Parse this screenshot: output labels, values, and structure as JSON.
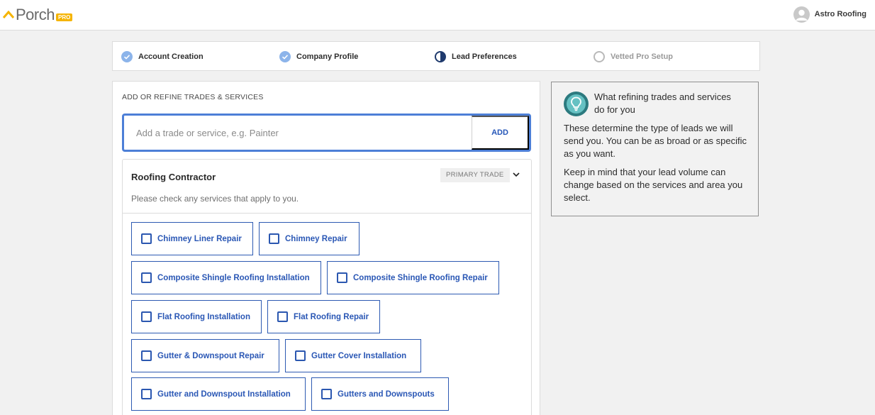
{
  "brand": {
    "logo_text": "Porch",
    "logo_badge": "PRO",
    "logo_color": "#f5b400"
  },
  "user": {
    "name": "Astro Roofing",
    "icon": "user-avatar-icon"
  },
  "stepper": {
    "steps": [
      {
        "label": "Account Creation",
        "status": "complete"
      },
      {
        "label": "Company Profile",
        "status": "complete"
      },
      {
        "label": "Lead Preferences",
        "status": "in-progress"
      },
      {
        "label": "Vetted Pro Setup",
        "status": "pending"
      }
    ]
  },
  "main": {
    "section_title": "ADD OR REFINE TRADES & SERVICES",
    "add": {
      "placeholder": "Add a trade or service, e.g. Painter",
      "value": "",
      "button_label": "ADD"
    },
    "trade": {
      "name": "Roofing Contractor",
      "badge": "PRIMARY TRADE",
      "subtitle": "Please check any services that apply to you.",
      "services": [
        {
          "label": "Chimney Liner Repair",
          "checked": false
        },
        {
          "label": "Chimney Repair",
          "checked": false
        },
        {
          "label": "Composite Shingle Roofing Installation",
          "checked": false
        },
        {
          "label": "Composite Shingle Roofing Repair",
          "checked": false
        },
        {
          "label": "Flat Roofing Installation",
          "checked": false
        },
        {
          "label": "Flat Roofing Repair",
          "checked": false
        },
        {
          "label": "Gutter & Downspout Repair",
          "checked": false
        },
        {
          "label": "Gutter Cover Installation",
          "checked": false
        },
        {
          "label": "Gutter and Downspout Installation",
          "checked": false
        },
        {
          "label": "Gutters and Downspouts",
          "checked": false
        }
      ]
    }
  },
  "info": {
    "icon": "lightbulb-icon",
    "title": "What refining trades and services do for you",
    "paragraph1": "These determine the type of leads we will send you. You can be as broad or as specific as you want.",
    "paragraph2": "Keep in mind that your lead volume can change based on the services and area you select."
  },
  "colors": {
    "accent": "#2a57b5",
    "step_complete": "#8cb4ea",
    "step_current": "#1f3a6d",
    "info_icon": "#2c7a7f"
  }
}
